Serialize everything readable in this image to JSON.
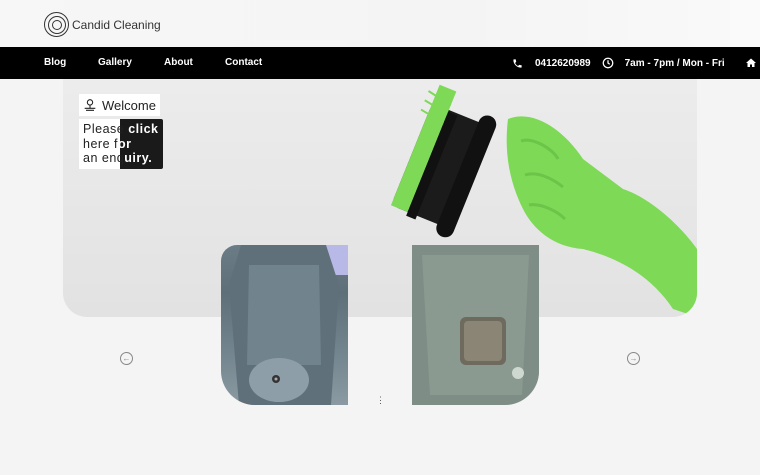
{
  "brand": {
    "name": "Candid Cleaning"
  },
  "nav": {
    "items": [
      {
        "label": "Blog"
      },
      {
        "label": "Gallery"
      },
      {
        "label": "About"
      },
      {
        "label": "Contact"
      }
    ],
    "phone": "0412620989",
    "hours": "7am - 7pm / Mon - Fri"
  },
  "hero": {
    "welcome": "Welcome",
    "enquiry_lines": [
      {
        "left": "Please ",
        "right": "click"
      },
      {
        "left": "here f",
        "right": "or"
      },
      {
        "left": "an enq",
        "right": "uiry."
      }
    ]
  },
  "colors": {
    "glove": "#7ed957",
    "navbar": "#000000"
  },
  "icons": [
    "logo-icon",
    "phone-icon",
    "clock-icon",
    "home-icon",
    "cleaning-icon",
    "arrow-left-icon",
    "arrow-right-icon"
  ]
}
